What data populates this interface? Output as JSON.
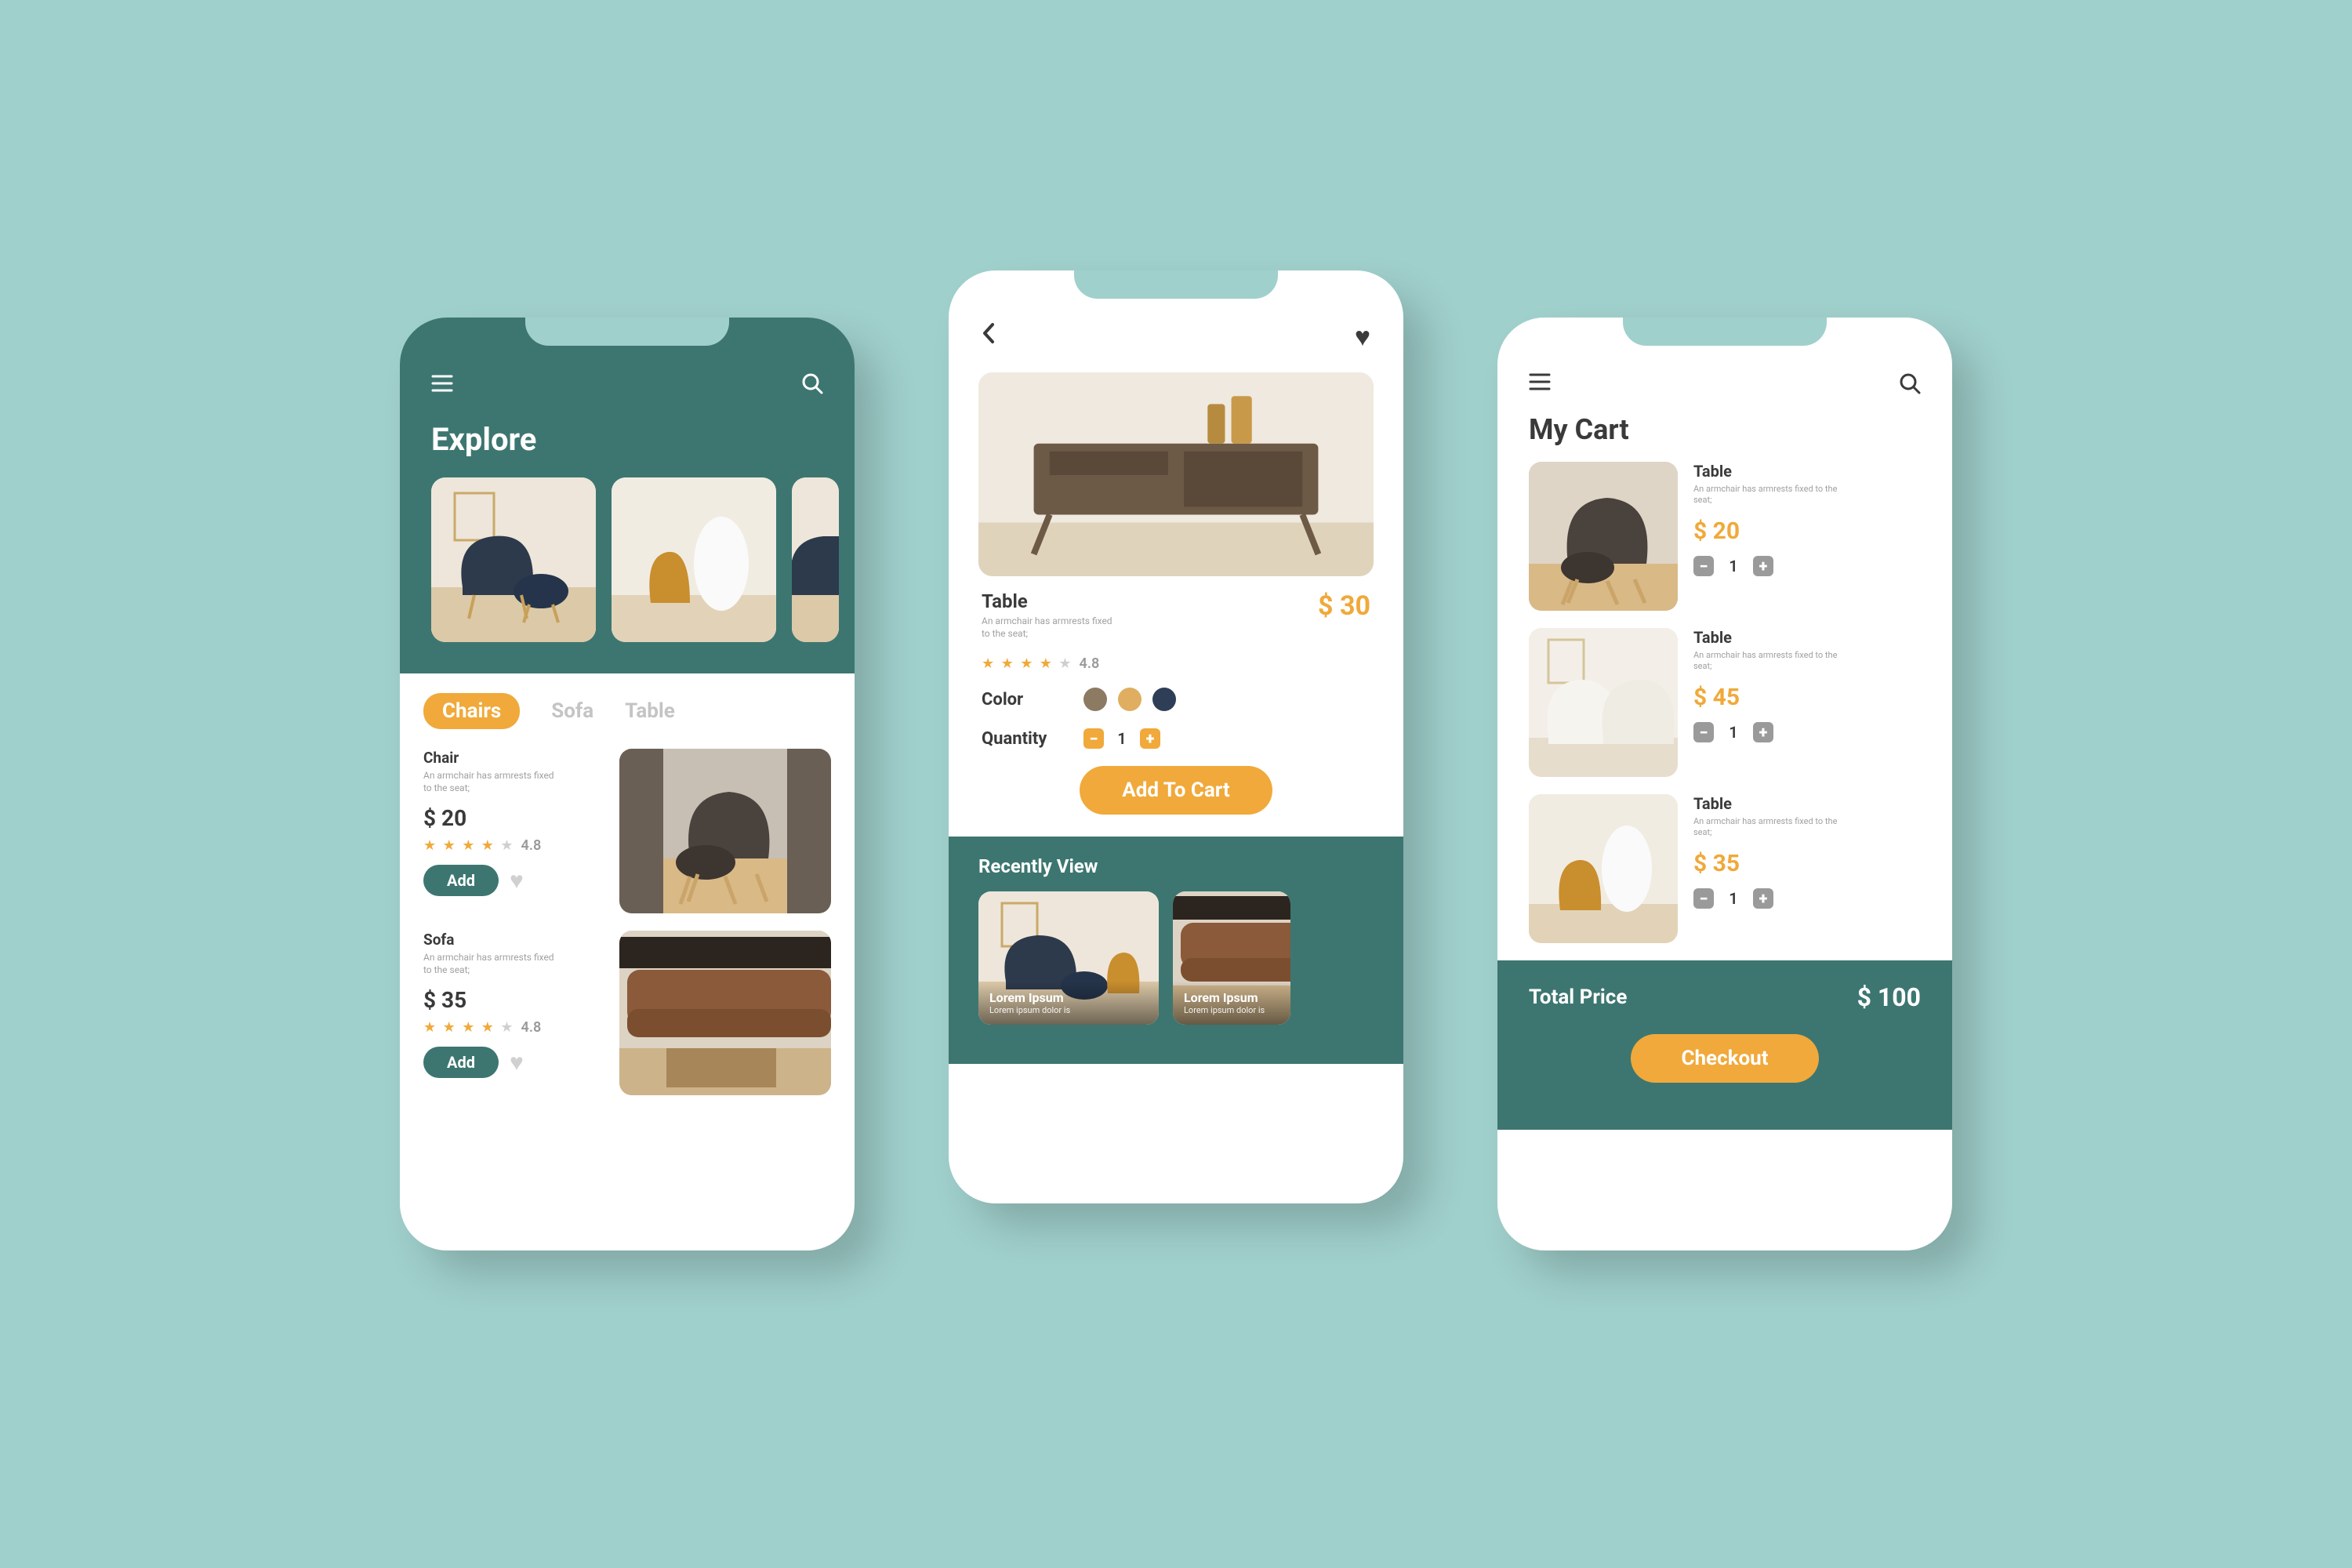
{
  "colors": {
    "teal": "#3d7670",
    "amber": "#f0a93a",
    "bg": "#a0d0cc"
  },
  "screen1": {
    "title": "Explore",
    "tabs": [
      "Chairs",
      "Sofa",
      "Table"
    ],
    "active_tab": 0,
    "products": [
      {
        "name": "Chair",
        "desc": "An armchair has armrests fixed to the seat;",
        "price": "$ 20",
        "rating": "4.8",
        "stars_filled": 4,
        "add_label": "Add"
      },
      {
        "name": "Sofa",
        "desc": "An armchair has armrests fixed to the seat;",
        "price": "$ 35",
        "rating": "4.8",
        "stars_filled": 4,
        "add_label": "Add"
      }
    ]
  },
  "screen2": {
    "name": "Table",
    "desc": "An armchair has armrests fixed to the seat;",
    "price": "$ 30",
    "rating": "4.8",
    "stars_filled": 4,
    "color_label": "Color",
    "color_swatches": [
      "#8c7a63",
      "#dfae61",
      "#2f3e57"
    ],
    "quantity_label": "Quantity",
    "quantity": "1",
    "cart_label": "Add To Cart",
    "recently_label": "Recently View",
    "recent": [
      {
        "title": "Lorem Ipsum",
        "sub": "Lorem ipsum dolor is"
      },
      {
        "title": "Lorem Ipsum",
        "sub": "Lorem ipsum dolor is"
      }
    ]
  },
  "screen3": {
    "title": "My Cart",
    "items": [
      {
        "name": "Table",
        "desc": "An armchair has armrests fixed to the seat;",
        "price": "$ 20",
        "qty": "1"
      },
      {
        "name": "Table",
        "desc": "An armchair has armrests fixed to the seat;",
        "price": "$ 45",
        "qty": "1"
      },
      {
        "name": "Table",
        "desc": "An armchair has armrests fixed to the seat;",
        "price": "$ 35",
        "qty": "1"
      }
    ],
    "total_label": "Total Price",
    "total": "$ 100",
    "checkout_label": "Checkout"
  }
}
